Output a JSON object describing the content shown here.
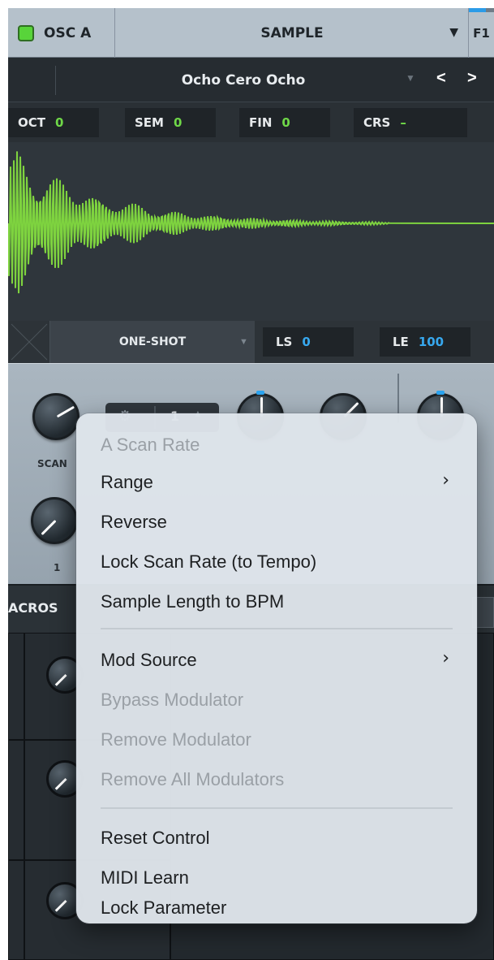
{
  "header": {
    "osc_label": "OSC A",
    "osc_enabled": true,
    "source_label": "SAMPLE",
    "filter_label": "F1",
    "accent_color": "#2b9be7",
    "led_color": "#58d43a"
  },
  "preset": {
    "name": "Ocho Cero Ocho"
  },
  "tuning": [
    {
      "label": "OCT",
      "value": "0"
    },
    {
      "label": "SEM",
      "value": "0"
    },
    {
      "label": "FIN",
      "value": "0"
    },
    {
      "label": "CRS",
      "value": "–"
    }
  ],
  "waveform": {
    "color": "#7ed33f"
  },
  "loop": {
    "mode": "ONE-SHOT",
    "ls_label": "LS",
    "ls_value": "0",
    "le_label": "LE",
    "le_value": "100"
  },
  "knobs": {
    "scan_label": "SCAN",
    "bottom_label": "1",
    "spin_value": "1"
  },
  "macros": {
    "title": "ACROS"
  },
  "context_menu": {
    "title": "A Scan Rate",
    "group1": [
      {
        "label": "Range",
        "submenu": true,
        "enabled": true
      },
      {
        "label": "Reverse",
        "enabled": true
      },
      {
        "label": "Lock Scan Rate (to Tempo)",
        "enabled": true
      },
      {
        "label": "Sample Length to BPM",
        "enabled": true
      }
    ],
    "group2": [
      {
        "label": "Mod Source",
        "submenu": true,
        "enabled": true
      },
      {
        "label": "Bypass Modulator",
        "enabled": false
      },
      {
        "label": "Remove Modulator",
        "enabled": false
      },
      {
        "label": "Remove All Modulators",
        "enabled": false
      }
    ],
    "group3": [
      {
        "label": "Reset Control",
        "enabled": true
      },
      {
        "label": "MIDI Learn",
        "enabled": true
      },
      {
        "label": "Lock Parameter",
        "enabled": true
      }
    ]
  }
}
